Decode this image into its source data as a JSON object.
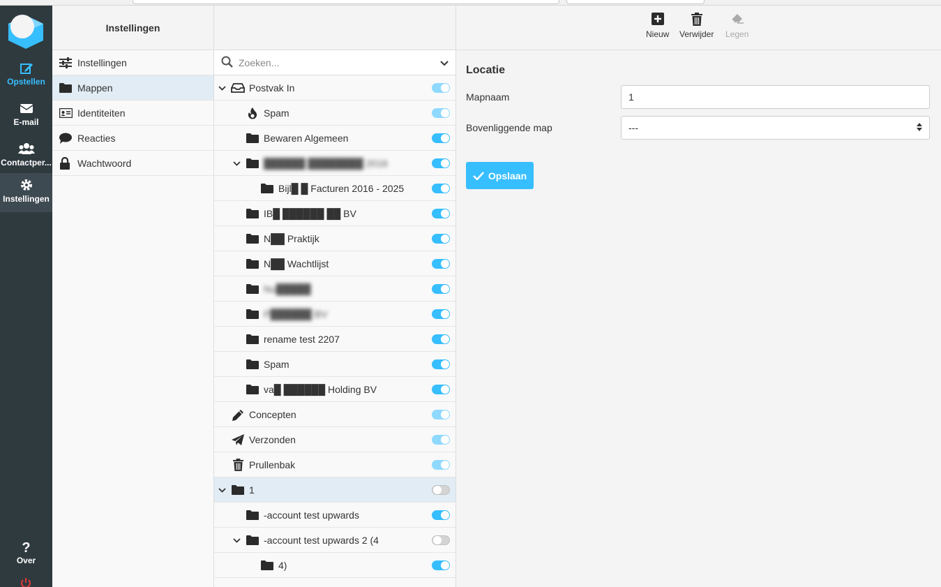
{
  "app_nav": {
    "items": [
      {
        "label": "Opstellen",
        "icon": "compose-icon"
      },
      {
        "label": "E-mail",
        "icon": "envelope-icon"
      },
      {
        "label": "Contactper...",
        "icon": "users-icon"
      },
      {
        "label": "Instellingen",
        "icon": "gear-icon"
      }
    ],
    "about_label": "Over"
  },
  "sections": {
    "header": "Instellingen",
    "items": [
      {
        "label": "Instellingen",
        "icon": "sliders-icon"
      },
      {
        "label": "Mappen",
        "icon": "folder-icon"
      },
      {
        "label": "Identiteiten",
        "icon": "id-card-icon"
      },
      {
        "label": "Reacties",
        "icon": "speech-bubble-icon"
      },
      {
        "label": "Wachtwoord",
        "icon": "lock-icon"
      }
    ]
  },
  "folders": {
    "search_placeholder": "Zoeken...",
    "items": [
      {
        "name": "Postvak In",
        "icon": "inbox-icon",
        "level": 0,
        "expanded": true,
        "toggle": "light",
        "blurred": false
      },
      {
        "name": "Spam",
        "icon": "fire-icon",
        "level": 1,
        "toggle": "light",
        "blurred": false
      },
      {
        "name": "Bewaren Algemeen",
        "icon": "folder-icon",
        "level": 1,
        "toggle": "on",
        "blurred": false
      },
      {
        "name": "██████ ████████ 2016",
        "icon": "folder-icon",
        "level": 1,
        "expanded": true,
        "toggle": "on",
        "blurred": true
      },
      {
        "name": "Bijl█ █  Facturen 2016 - 2025",
        "icon": "folder-icon",
        "level": 2,
        "toggle": "on",
        "blurred": false
      },
      {
        "name": "IB█ ██████ ██ BV",
        "icon": "folder-icon",
        "level": 1,
        "toggle": "on",
        "blurred": false
      },
      {
        "name": "N██ Praktijk",
        "icon": "folder-icon",
        "level": 1,
        "toggle": "on",
        "blurred": false
      },
      {
        "name": "N██ Wachtlijst",
        "icon": "folder-icon",
        "level": 1,
        "toggle": "on",
        "blurred": false
      },
      {
        "name": "Nu█████",
        "icon": "folder-icon",
        "level": 1,
        "toggle": "on",
        "blurred": true
      },
      {
        "name": "P██████ BV",
        "icon": "folder-icon",
        "level": 1,
        "toggle": "on",
        "blurred": true
      },
      {
        "name": "rename test 2207",
        "icon": "folder-icon",
        "level": 1,
        "toggle": "on",
        "blurred": false
      },
      {
        "name": "Spam",
        "icon": "folder-icon",
        "level": 1,
        "toggle": "on",
        "blurred": false
      },
      {
        "name": "va█ ██████ Holding BV",
        "icon": "folder-icon",
        "level": 1,
        "toggle": "on",
        "blurred": false
      },
      {
        "name": "Concepten",
        "icon": "pencil-icon",
        "level": 0,
        "toggle": "light",
        "blurred": false
      },
      {
        "name": "Verzonden",
        "icon": "paper-plane-icon",
        "level": 0,
        "toggle": "light",
        "blurred": false
      },
      {
        "name": "Prullenbak",
        "icon": "trash-icon",
        "level": 0,
        "toggle": "light",
        "blurred": false
      },
      {
        "name": "1",
        "icon": "folder-icon",
        "level": 0,
        "expanded": true,
        "toggle": "off",
        "selected": true,
        "blurred": false
      },
      {
        "name": "-account test upwards",
        "icon": "folder-icon",
        "level": 1,
        "toggle": "on",
        "blurred": false
      },
      {
        "name": "-account test upwards 2 (4",
        "icon": "folder-icon",
        "level": 1,
        "expanded": true,
        "toggle": "off",
        "blurred": false
      },
      {
        "name": "4)",
        "icon": "folder-icon",
        "level": 2,
        "toggle": "on",
        "blurred": false
      }
    ]
  },
  "toolbar": {
    "new_label": "Nieuw",
    "delete_label": "Verwijder",
    "empty_label": "Legen"
  },
  "form": {
    "title": "Locatie",
    "name_label": "Mapnaam",
    "name_value": "1",
    "parent_label": "Bovenliggende map",
    "parent_value": "---",
    "save_label": "Opslaan"
  },
  "colors": {
    "accent": "#37beff",
    "sidebar": "#2f3a3f"
  }
}
